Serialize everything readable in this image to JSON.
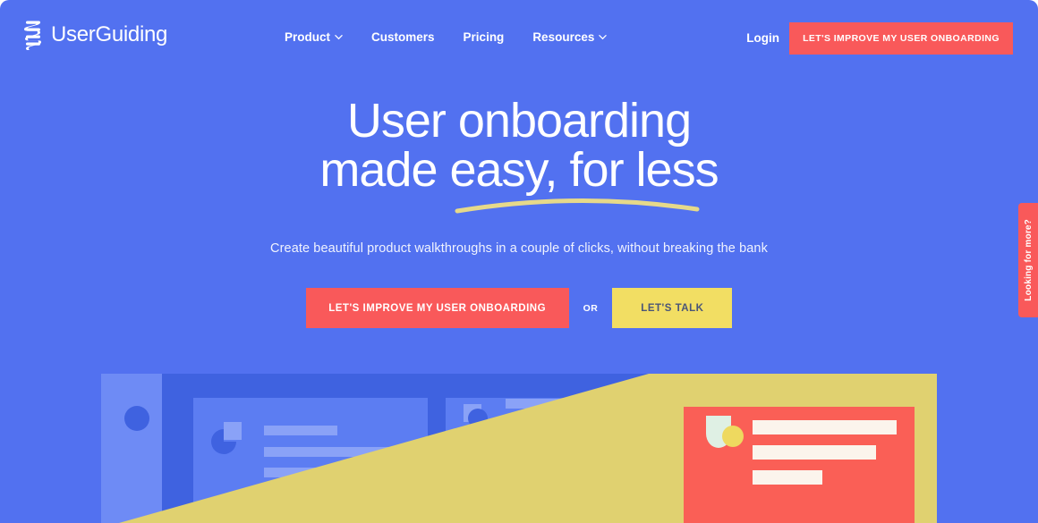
{
  "brand": {
    "name": "UserGuiding",
    "logo_icon": "userguiding-coil-logo-icon"
  },
  "nav": {
    "items": [
      {
        "label": "Product",
        "has_caret": true
      },
      {
        "label": "Customers",
        "has_caret": false
      },
      {
        "label": "Pricing",
        "has_caret": false
      },
      {
        "label": "Resources",
        "has_caret": true
      }
    ],
    "login_label": "Login",
    "cta_label": "LET'S IMPROVE MY USER ONBOARDING"
  },
  "hero": {
    "headline_line1": "User onboarding",
    "headline_line2": "made easy, for less",
    "subtitle": "Create beautiful product walkthroughs in a couple of clicks, without breaking the bank",
    "primary_cta": "LET'S IMPROVE MY USER ONBOARDING",
    "or_label": "OR",
    "secondary_cta": "LET'S TALK"
  },
  "side_tab": {
    "label": "Looking for more?"
  },
  "colors": {
    "background_blue": "#5271F0",
    "accent_coral": "#F9595A",
    "accent_yellow": "#F2DE63",
    "text_white": "#FFFFFF",
    "secondary_button_text": "#4A5578",
    "illus_panel_light": "#6E8BF5",
    "illus_panel_dark": "#3F62E0",
    "illus_card": "#5C7DF2",
    "illus_bar": "#8AA2F7",
    "illus_mint": "#DFF0E4"
  },
  "illustration": {
    "name": "dashboard-mockup-illustration",
    "sidebar_avatar": "avatar-circle-icon",
    "card1_icon": "pie-chart-icon",
    "card2_icon": "pie-chart-icon",
    "red_card_icon": "shield-badge-icon",
    "card1_bars": 3,
    "card2_bars": 3,
    "red_card_bars": 3
  }
}
